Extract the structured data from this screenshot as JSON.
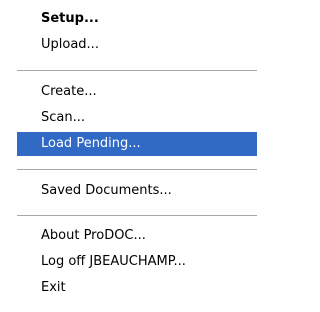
{
  "menu": {
    "items": [
      {
        "label": "Setup..."
      },
      {
        "label": "Upload..."
      },
      {
        "label": "Create..."
      },
      {
        "label": "Scan..."
      },
      {
        "label": "Load Pending..."
      },
      {
        "label": "Saved Documents..."
      },
      {
        "label": "About ProDOC..."
      },
      {
        "label": "Log off JBEAUCHAMP..."
      },
      {
        "label": "Exit"
      }
    ],
    "highlight_color": "#316ac5",
    "highlight_text_color": "#ffffff",
    "separator_color": "#a7a6aa"
  }
}
